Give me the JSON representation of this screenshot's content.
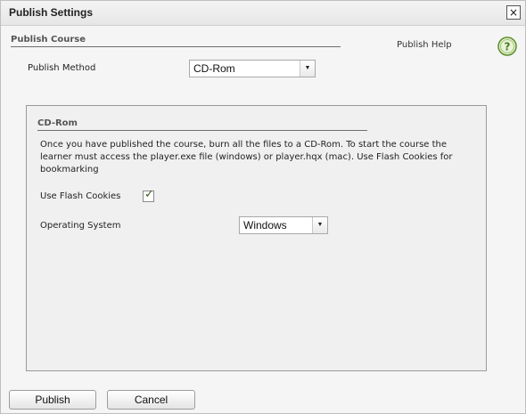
{
  "window": {
    "title": "Publish Settings",
    "close_label": "×"
  },
  "publish_course": {
    "header": "Publish Course",
    "help_link": "Publish Help",
    "help_icon": "question-icon",
    "method_label": "Publish Method",
    "method_value": "CD-Rom"
  },
  "cdrom": {
    "header": "CD-Rom",
    "description": "Once you have published the course, burn all the files to a CD-Rom. To start the course the learner must access the player.exe file (windows) or player.hqx (mac). Use Flash Cookies for bookmarking",
    "flash_cookies_label": "Use Flash Cookies",
    "flash_cookies_checked": true,
    "os_label": "Operating System",
    "os_value": "Windows"
  },
  "footer": {
    "publish_label": "Publish",
    "cancel_label": "Cancel"
  },
  "colors": {
    "help_icon_green": "#5a8c2a",
    "check_green": "#3a5a1a"
  }
}
